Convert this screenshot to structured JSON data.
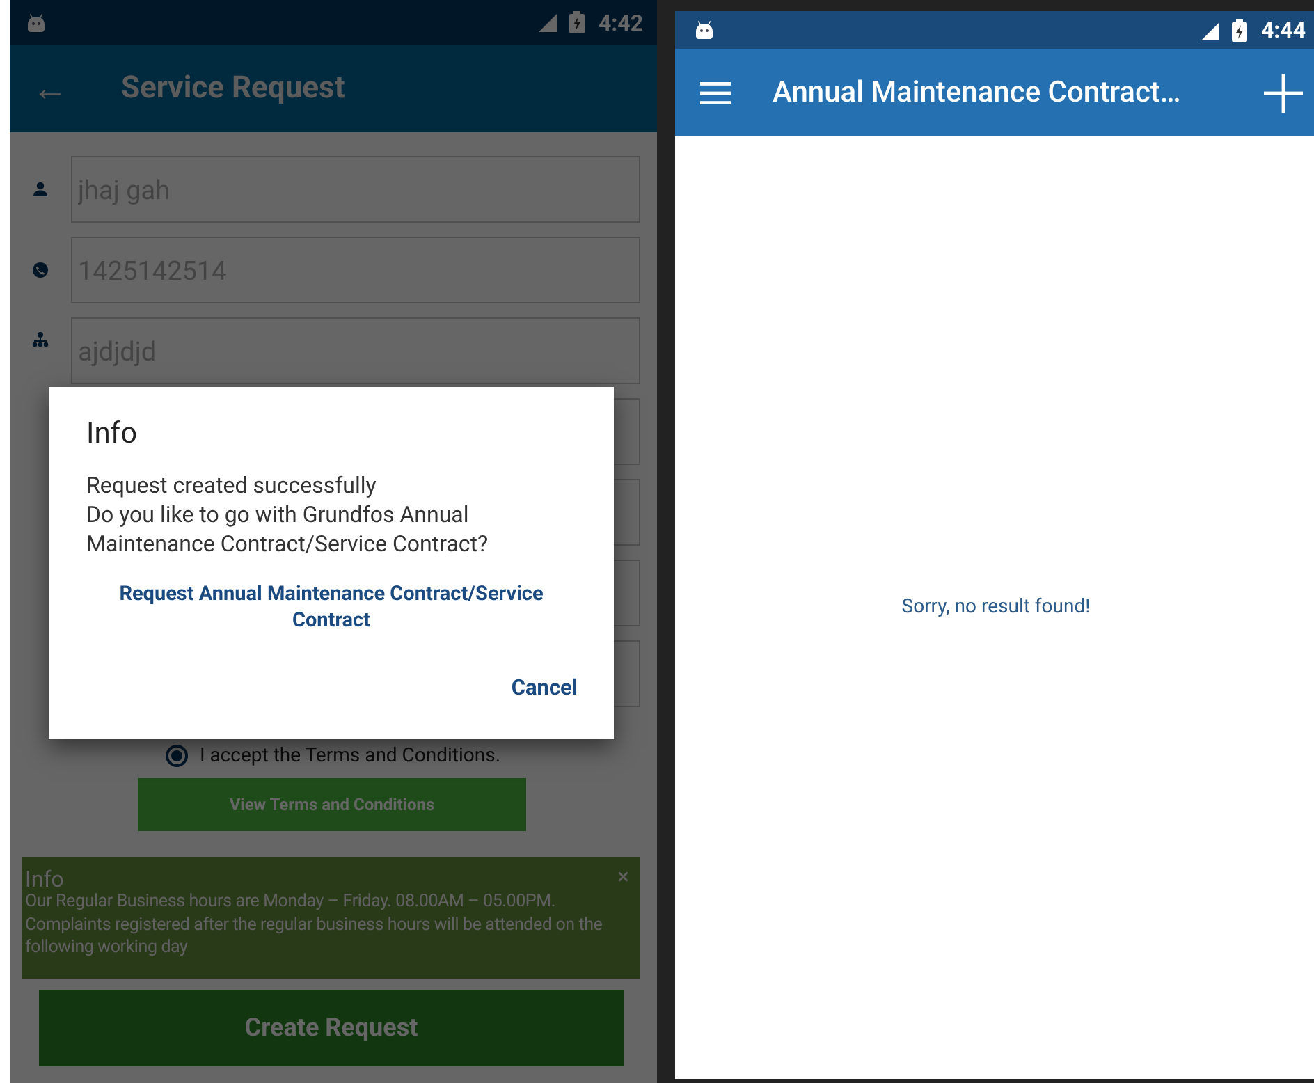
{
  "left_screen": {
    "status_bar": {
      "time": "4:42"
    },
    "app_bar": {
      "title": "Service Request",
      "back_icon": "←"
    },
    "fields": [
      {
        "kind": "person",
        "value": "jhaj gah"
      },
      {
        "kind": "phone",
        "value": "1425142514"
      },
      {
        "kind": "network",
        "value": "ajdjdjd"
      },
      {
        "kind": "blank"
      },
      {
        "kind": "blank"
      },
      {
        "kind": "blank"
      },
      {
        "kind": "blank"
      }
    ],
    "terms_radio": {
      "label": "I accept the Terms and Conditions.",
      "selected": true
    },
    "terms_button": "View Terms and Conditions",
    "info_banner": {
      "title": "Info",
      "text": "Our Regular Business hours are Monday – Friday. 08.00AM – 05.00PM. Complaints registered after the regular business hours will be attended on the following working day",
      "close": "×"
    },
    "create_button": "Create Request",
    "dialog": {
      "title": "Info",
      "message_lines": [
        "Request created successfully",
        "Do you like to go with Grundfos Annual Maintenance Contract/Service Contract?"
      ],
      "link": "Request Annual Maintenance Contract/Service Contract",
      "cancel": "Cancel"
    }
  },
  "right_screen": {
    "status_bar": {
      "time": "4:44"
    },
    "app_bar": {
      "title": "Annual Maintenance Contract…"
    },
    "empty_message": "Sorry, no result found!"
  }
}
